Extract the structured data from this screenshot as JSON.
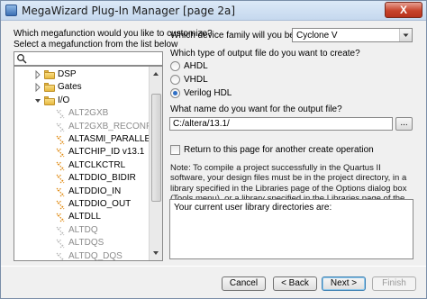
{
  "window": {
    "title": "MegaWizard Plug-In Manager [page 2a]",
    "close_glyph": "X"
  },
  "left": {
    "question": "Which megafunction would you like to customize?",
    "instruction": "Select a megafunction from the list below",
    "search_value": "",
    "tree": [
      {
        "label": "DSP",
        "type": "folder",
        "expanded": false
      },
      {
        "label": "Gates",
        "type": "folder",
        "expanded": false
      },
      {
        "label": "I/O",
        "type": "folder",
        "expanded": true
      },
      {
        "label": "ALT2GXB",
        "type": "item",
        "enabled": false
      },
      {
        "label": "ALT2GXB_RECONFIG",
        "type": "item",
        "enabled": false
      },
      {
        "label": "ALTASMI_PARALLEL",
        "type": "item",
        "enabled": true
      },
      {
        "label": "ALTCHIP_ID v13.1",
        "type": "item",
        "enabled": true
      },
      {
        "label": "ALTCLKCTRL",
        "type": "item",
        "enabled": true
      },
      {
        "label": "ALTDDIO_BIDIR",
        "type": "item",
        "enabled": true
      },
      {
        "label": "ALTDDIO_IN",
        "type": "item",
        "enabled": true
      },
      {
        "label": "ALTDDIO_OUT",
        "type": "item",
        "enabled": true
      },
      {
        "label": "ALTDLL",
        "type": "item",
        "enabled": true
      },
      {
        "label": "ALTDQ",
        "type": "item",
        "enabled": false
      },
      {
        "label": "ALTDQS",
        "type": "item",
        "enabled": false
      },
      {
        "label": "ALTDQ_DQS",
        "type": "item",
        "enabled": false
      }
    ]
  },
  "right": {
    "device_family_label": "Which device family will you be using?",
    "device_family_value": "Cyclone V",
    "output_type_label": "Which type of output file do you want to create?",
    "output_types": [
      {
        "label": "AHDL",
        "checked": false
      },
      {
        "label": "VHDL",
        "checked": false
      },
      {
        "label": "Verilog HDL",
        "checked": true
      }
    ],
    "output_name_label": "What name do you want for the output file?",
    "output_path": "C:/altera/13.1/",
    "browse_label": "...",
    "return_label": "Return to this page for another create operation",
    "return_checked": false,
    "note": "Note: To compile a project successfully in the Quartus II software, your design files must be in the project directory, in a library specified in the Libraries page of the Options dialog box (Tools menu), or a library specified in the Libraries page of the Settings dialog box (Assignments menu).",
    "libdir_label": "Your current user library directories are:"
  },
  "buttons": {
    "cancel": "Cancel",
    "back": "< Back",
    "next": "Next >",
    "finish": "Finish"
  },
  "colors": {
    "selected_radio": "#2f6fc5",
    "folder": "#e6b83e",
    "close": "#c7442c"
  }
}
